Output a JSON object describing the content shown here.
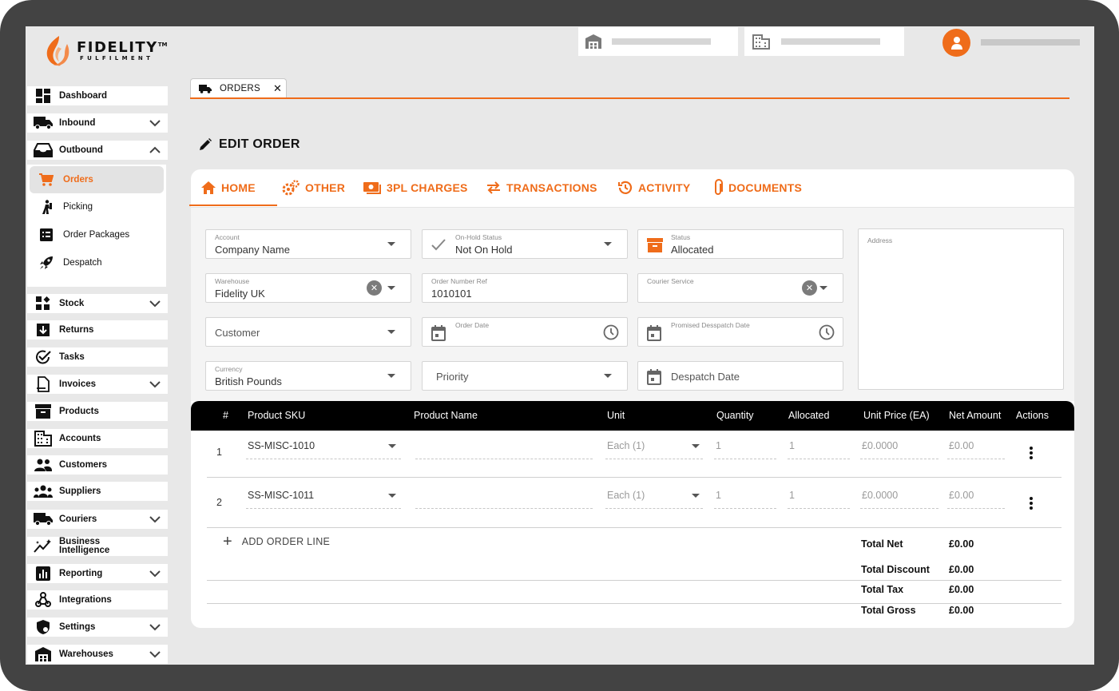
{
  "brand": {
    "name": "FIDELITY",
    "tm": "TM",
    "sub": "FULFILMENT",
    "accent": "#ef6c1a"
  },
  "sidebar": {
    "items": [
      {
        "label": "Dashboard",
        "icon": "dashboard-icon",
        "chevron": ""
      },
      {
        "label": "Inbound",
        "icon": "truck-icon",
        "chevron": "down"
      },
      {
        "label": "Outbound",
        "icon": "inbox-tray-icon",
        "chevron": "up"
      },
      {
        "label": "Stock",
        "icon": "widgets-icon",
        "chevron": "down"
      },
      {
        "label": "Returns",
        "icon": "return-box-icon",
        "chevron": ""
      },
      {
        "label": "Tasks",
        "icon": "check-circle-icon",
        "chevron": ""
      },
      {
        "label": "Invoices",
        "icon": "document-icon",
        "chevron": "down"
      },
      {
        "label": "Products",
        "icon": "archive-icon",
        "chevron": ""
      },
      {
        "label": "Accounts",
        "icon": "building-icon",
        "chevron": ""
      },
      {
        "label": "Customers",
        "icon": "people-icon",
        "chevron": ""
      },
      {
        "label": "Suppliers",
        "icon": "groups-icon",
        "chevron": ""
      },
      {
        "label": "Couriers",
        "icon": "truck-icon",
        "chevron": "down"
      },
      {
        "label": "Business Intelligence",
        "icon": "insights-icon",
        "chevron": ""
      },
      {
        "label": "Reporting",
        "icon": "bar-chart-icon",
        "chevron": "down"
      },
      {
        "label": "Integrations",
        "icon": "webhook-icon",
        "chevron": ""
      },
      {
        "label": "Settings",
        "icon": "shield-gear-icon",
        "chevron": "down"
      },
      {
        "label": "Warehouses",
        "icon": "warehouse-icon",
        "chevron": "down"
      }
    ],
    "sub_items": [
      {
        "label": "Orders",
        "icon": "cart-icon",
        "active": true
      },
      {
        "label": "Picking",
        "icon": "person-picking-icon",
        "active": false
      },
      {
        "label": "Order Packages",
        "icon": "list-box-icon",
        "active": false
      },
      {
        "label": "Despatch",
        "icon": "rocket-icon",
        "active": false
      }
    ]
  },
  "page_tab": {
    "label": "ORDERS",
    "close": "✕"
  },
  "page_title": "EDIT ORDER",
  "tabs": [
    {
      "label": "HOME",
      "icon": "home-icon"
    },
    {
      "label": "OTHER",
      "icon": "gears-icon"
    },
    {
      "label": "3PL CHARGES",
      "icon": "money-icon"
    },
    {
      "label": "TRANSACTIONS",
      "icon": "swap-icon"
    },
    {
      "label": "ACTIVITY",
      "icon": "history-icon"
    },
    {
      "label": "DOCUMENTS",
      "icon": "paperclip-icon"
    }
  ],
  "form": {
    "account": {
      "label": "Account",
      "value": "Company Name"
    },
    "on_hold": {
      "label": "On-Hold Status",
      "value": "Not On Hold"
    },
    "status": {
      "label": "Status",
      "value": "Allocated"
    },
    "warehouse": {
      "label": "Warehouse",
      "value": "Fidelity UK"
    },
    "order_ref": {
      "label": "Order Number Ref",
      "value": "1010101"
    },
    "courier": {
      "label": "Courier Service",
      "value": ""
    },
    "customer": {
      "placeholder": "Customer"
    },
    "order_date": {
      "label": "Order Date"
    },
    "promised": {
      "label": "Promised Desspatch Date"
    },
    "currency": {
      "label": "Currency",
      "value": "British Pounds"
    },
    "priority": {
      "placeholder": "Priority"
    },
    "despatch": {
      "placeholder": "Despatch Date"
    },
    "address": {
      "label": "Address"
    }
  },
  "table": {
    "headers": [
      "#",
      "Product SKU",
      "Product Name",
      "Unit",
      "Quantity",
      "Allocated",
      "Unit Price (EA)",
      "Net Amount",
      "Actions"
    ],
    "rows": [
      {
        "num": "1",
        "sku": "SS-MISC-1010",
        "name": "",
        "unit": "Each (1)",
        "qty": "1",
        "allocated": "1",
        "unit_price": "£0.0000",
        "net": "£0.00"
      },
      {
        "num": "2",
        "sku": "SS-MISC-1011",
        "name": "",
        "unit": "Each (1)",
        "qty": "1",
        "allocated": "1",
        "unit_price": "£0.0000",
        "net": "£0.00"
      }
    ],
    "add_line": "ADD ORDER LINE"
  },
  "totals": [
    {
      "label": "Total Net",
      "value": "£0.00"
    },
    {
      "label": "Total Discount",
      "value": "£0.00"
    },
    {
      "label": "Total Tax",
      "value": "£0.00"
    },
    {
      "label": "Total Gross",
      "value": "£0.00"
    }
  ]
}
